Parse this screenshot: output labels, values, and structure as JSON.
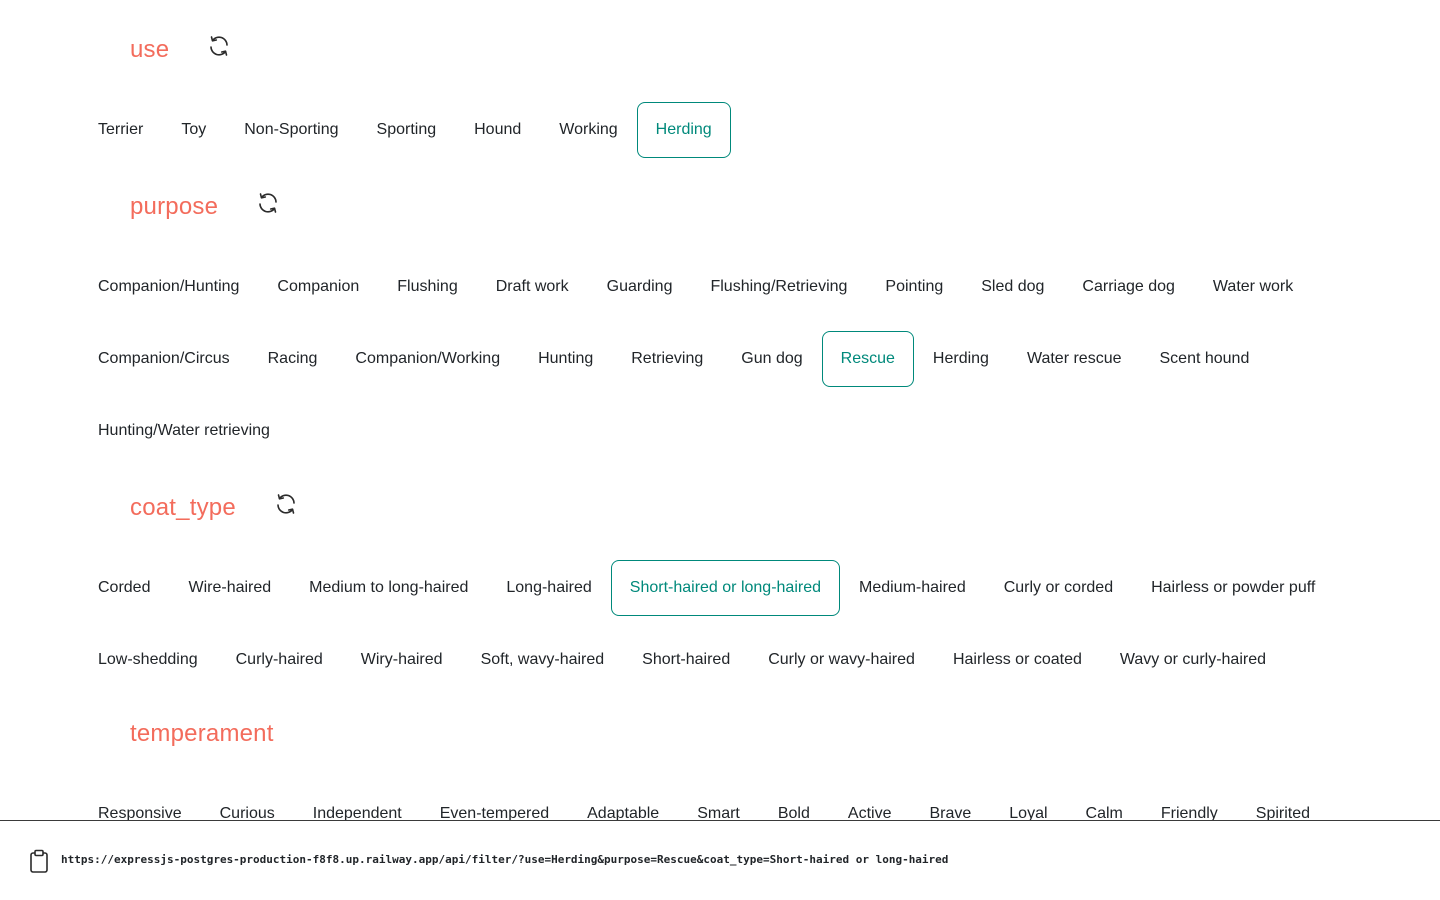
{
  "sections": {
    "use": {
      "title": "use",
      "options": [
        "Terrier",
        "Toy",
        "Non-Sporting",
        "Sporting",
        "Hound",
        "Working",
        "Herding"
      ],
      "selected": "Herding"
    },
    "purpose": {
      "title": "purpose",
      "options_row1": [
        "Companion/Hunting",
        "Companion",
        "Flushing",
        "Draft work",
        "Guarding",
        "Flushing/Retrieving",
        "Pointing",
        "Sled dog",
        "Carriage dog",
        "Water work"
      ],
      "options_row2": [
        "Companion/Circus",
        "Racing",
        "Companion/Working",
        "Hunting",
        "Retrieving",
        "Gun dog",
        "Rescue",
        "Herding",
        "Water rescue",
        "Scent hound"
      ],
      "options_row3": [
        "Hunting/Water retrieving"
      ],
      "selected": "Rescue"
    },
    "coat_type": {
      "title": "coat_type",
      "options_row1": [
        "Corded",
        "Wire-haired",
        "Medium to long-haired",
        "Long-haired",
        "Short-haired or long-haired",
        "Medium-haired",
        "Curly or corded",
        "Hairless or powder puff"
      ],
      "options_row2": [
        "Low-shedding",
        "Curly-haired",
        "Wiry-haired",
        "Soft, wavy-haired",
        "Short-haired",
        "Curly or wavy-haired",
        "Hairless or coated",
        "Wavy or curly-haired"
      ],
      "selected": "Short-haired or long-haired"
    },
    "temperament": {
      "title": "temperament",
      "options_row1": [
        "Responsive",
        "Curious",
        "Independent",
        "Even-tempered",
        "Adaptable",
        "Smart",
        "Bold",
        "Active",
        "Brave",
        "Loyal",
        "Calm",
        "Friendly",
        "Spirited"
      ]
    }
  },
  "footer": {
    "url": "https://expressjs-postgres-production-f8f8.up.railway.app/api/filter/?use=Herding&purpose=Rescue&coat_type=Short-haired or long-haired",
    "icon": "clipboard-icon"
  },
  "colors": {
    "accent": "#f36c5c",
    "selected": "#00897b",
    "text": "#212529"
  }
}
